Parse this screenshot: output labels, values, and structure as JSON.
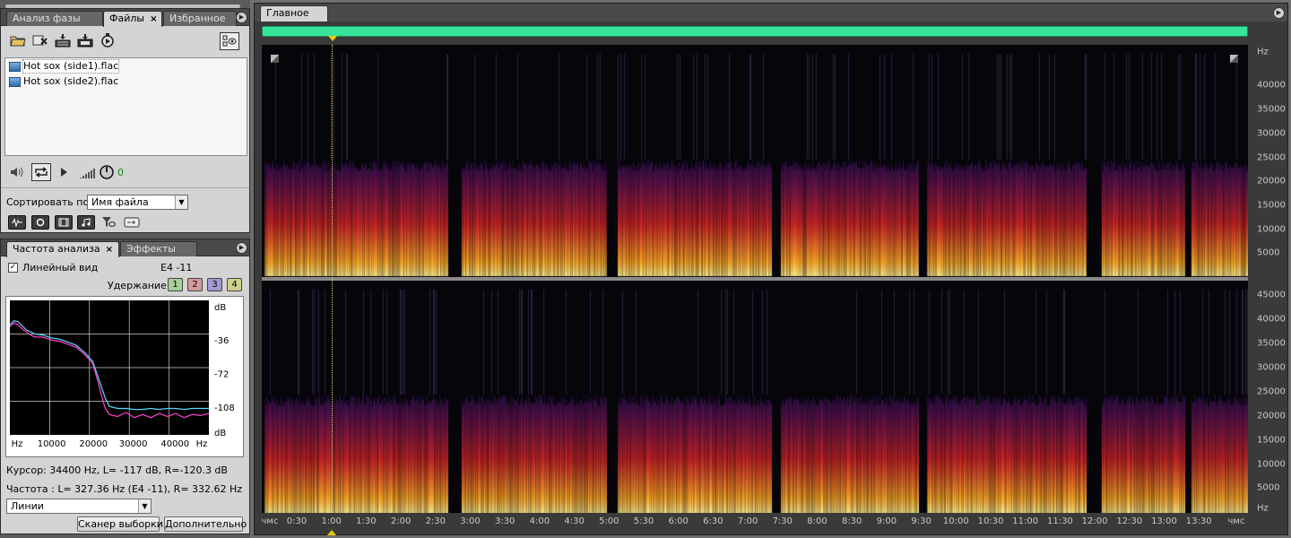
{
  "files_panel": {
    "tabs": [
      {
        "label": "Анализ фазы",
        "active": false
      },
      {
        "label": "Файлы",
        "active": true
      },
      {
        "label": "Избранное",
        "active": false
      }
    ],
    "tab_close": "×",
    "toolbar_icons": [
      "open-file-icon",
      "close-file-icon",
      "insert-multitrack-icon",
      "insert-cd-icon",
      "autoplay-icon",
      "view-options-icon"
    ],
    "files": [
      {
        "name": "Hot sox (side1).flac",
        "selected": true
      },
      {
        "name": "Hot sox (side2).flac",
        "selected": false
      }
    ],
    "preview_volume": "0",
    "sort_label": "Сортировать по:",
    "sort_value": "Имя файла"
  },
  "analysis_panel": {
    "tabs": [
      {
        "label": "Частота  анализа",
        "active": true
      },
      {
        "label": "Эффекты",
        "active": false
      }
    ],
    "tab_close": "×",
    "linear_view_label": "Линейный вид",
    "linear_view_checked": true,
    "check_mark": "✓",
    "note_readout": "E4 -11",
    "hold_label": "Удержание:",
    "hold_buttons": [
      {
        "label": "1",
        "color": "#a6cf9a"
      },
      {
        "label": "2",
        "color": "#d59a9a"
      },
      {
        "label": "3",
        "color": "#a29ad2"
      },
      {
        "label": "4",
        "color": "#cfcf8e"
      }
    ],
    "cursor_text": "Курсор:  34400 Hz, L=  -117 dB, R=-120.3 dB",
    "freq_text": "Частота :    L= 327.36 Hz (E4 -11), R= 332.62 Hz (...",
    "view_mode": "Линии",
    "scan_button": "Сканер выборки",
    "advanced_button": "Дополнительно"
  },
  "chart_data": {
    "type": "line",
    "x_ticks": [
      "Hz",
      "10000",
      "20000",
      "30000",
      "40000",
      "Hz"
    ],
    "y_ticks": [
      "dB",
      "-36",
      "-72",
      "-108",
      "dB"
    ],
    "xlim": [
      0,
      48000
    ],
    "ylim": [
      -132,
      0
    ],
    "grid": true,
    "series": [
      {
        "color": "#5fd6ff",
        "x": [
          0,
          1000,
          2000,
          3000,
          4000,
          5000,
          6000,
          8000,
          10000,
          12000,
          14000,
          16000,
          18000,
          20000,
          21000,
          22000,
          23000,
          24000,
          26000,
          28000,
          30000,
          32000,
          34000,
          36000,
          38000,
          40000,
          42000,
          44000,
          46000,
          48000
        ],
        "y": [
          -24,
          -20,
          -21,
          -25,
          -29,
          -31,
          -33,
          -34,
          -37,
          -38,
          -41,
          -44,
          -51,
          -60,
          -72,
          -84,
          -96,
          -104,
          -106,
          -106,
          -107,
          -107,
          -106,
          -107,
          -106,
          -106,
          -107,
          -106,
          -106,
          -106
        ]
      },
      {
        "color": "#ff45c8",
        "x": [
          0,
          1000,
          2000,
          3000,
          4000,
          5000,
          6000,
          8000,
          10000,
          12000,
          14000,
          16000,
          18000,
          20000,
          21000,
          22000,
          23000,
          24000,
          26000,
          28000,
          30000,
          32000,
          34000,
          36000,
          38000,
          40000,
          42000,
          44000,
          46000,
          48000
        ],
        "y": [
          -26,
          -22,
          -24,
          -28,
          -31,
          -34,
          -36,
          -36,
          -39,
          -40,
          -43,
          -46,
          -53,
          -62,
          -76,
          -92,
          -106,
          -112,
          -114,
          -110,
          -115,
          -112,
          -115,
          -111,
          -114,
          -111,
          -115,
          -112,
          -113,
          -111
        ]
      }
    ]
  },
  "editor": {
    "tab_label": "Главное",
    "overview_color": "#38e39a",
    "freq_labels_top": [
      "Hz",
      "40000",
      "35000",
      "30000",
      "25000",
      "20000",
      "15000",
      "10000",
      "5000"
    ],
    "freq_labels_bottom": [
      "45000",
      "40000",
      "35000",
      "30000",
      "25000",
      "20000",
      "15000",
      "10000",
      "5000",
      "Hz"
    ],
    "time_labels": [
      "чмс",
      "0:30",
      "1:00",
      "1:30",
      "2:00",
      "2:30",
      "3:00",
      "3:30",
      "4:00",
      "4:30",
      "5:00",
      "5:30",
      "6:00",
      "6:30",
      "7:00",
      "7:30",
      "8:00",
      "8:30",
      "9:00",
      "9:30",
      "10:00",
      "10:30",
      "11:00",
      "11:30",
      "12:00",
      "12:30",
      "13:00",
      "13:30",
      "чмс"
    ],
    "playhead_time": "1:00"
  }
}
